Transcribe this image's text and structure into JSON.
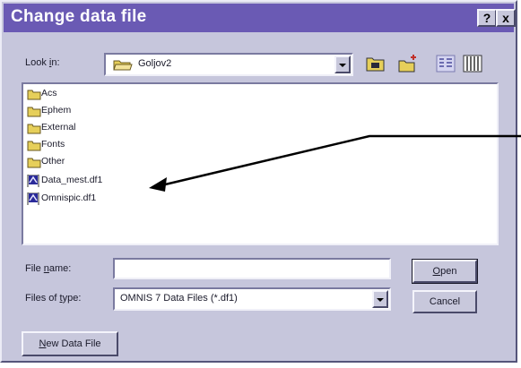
{
  "dialog": {
    "title": "Change data file",
    "help_button": "?",
    "close_button": "x"
  },
  "lookin": {
    "label_prefix": "Look ",
    "label_key": "i",
    "label_suffix": "n:",
    "value": "Goljov2"
  },
  "files": {
    "items": [
      {
        "name": "Acs",
        "icon": "folder-icon"
      },
      {
        "name": "Ephem",
        "icon": "folder-icon"
      },
      {
        "name": "External",
        "icon": "folder-icon"
      },
      {
        "name": "Fonts",
        "icon": "folder-icon"
      },
      {
        "name": "Other",
        "icon": "folder-icon"
      },
      {
        "name": "Data_mest.df1",
        "icon": "data-file-icon"
      },
      {
        "name": "Omnispic.df1",
        "icon": "data-file-icon"
      }
    ]
  },
  "filename": {
    "label_prefix": "File ",
    "label_key": "n",
    "label_suffix": "ame:",
    "value": ""
  },
  "filetype": {
    "label_prefix": "Files of ",
    "label_key": "t",
    "label_suffix": "ype:",
    "value": "OMNIS 7 Data Files (*.df1)"
  },
  "buttons": {
    "open_key": "O",
    "open_rest": "pen",
    "cancel": "Cancel",
    "new_key": "N",
    "new_rest": "ew Data File"
  },
  "colors": {
    "titlebar": "#6a5ab4",
    "dialog_bg": "#c6c6dc",
    "folder": "#e6cf5a"
  }
}
